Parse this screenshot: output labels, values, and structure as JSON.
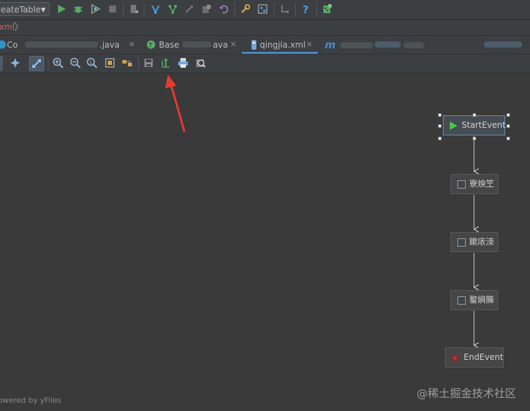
{
  "toolbar": {
    "run_config": "eateTable",
    "icons": [
      "run-icon",
      "debug-icon",
      "coverage-icon",
      "stop-icon",
      "build-icon",
      "vcs-update-icon",
      "vcs-commit-icon",
      "vcs-push-icon",
      "vcs-history-icon",
      "revert-icon",
      "settings-icon",
      "project-structure-icon",
      "sdk-icon",
      "help-icon",
      "plugin-icon"
    ]
  },
  "breadcrumb": {
    "label": "xml"
  },
  "tabs": [
    {
      "label": "Co",
      "tail": ".java",
      "icon": "java-class-icon"
    },
    {
      "label": "Base",
      "tail": "ava",
      "icon": "java-test-icon"
    },
    {
      "label": "qingjia.xml",
      "active": true,
      "icon": "xml-file-icon"
    },
    {
      "label": "m",
      "icon": "maven-icon"
    }
  ],
  "colors": {
    "background": "#3c3f41",
    "canvas": "#3a3a3a",
    "accent": "#4a88c7",
    "annotation_arrow": "#e53a2f",
    "start_event": "#4dc44d",
    "end_event": "#c0392b"
  },
  "diagram": {
    "nodes": [
      {
        "id": "start",
        "label": "StartEvent",
        "type": "start",
        "selected": true
      },
      {
        "id": "task1",
        "label": "寮炴笁",
        "type": "task"
      },
      {
        "id": "task2",
        "label": "鏉庡洓",
        "type": "task"
      },
      {
        "id": "task3",
        "label": "鐜嬩簲",
        "type": "task"
      },
      {
        "id": "end",
        "label": "EndEvent",
        "type": "end"
      }
    ]
  },
  "footer": {
    "powered_by": "owered by yFiles",
    "watermark": "@稀土掘金技术社区"
  }
}
